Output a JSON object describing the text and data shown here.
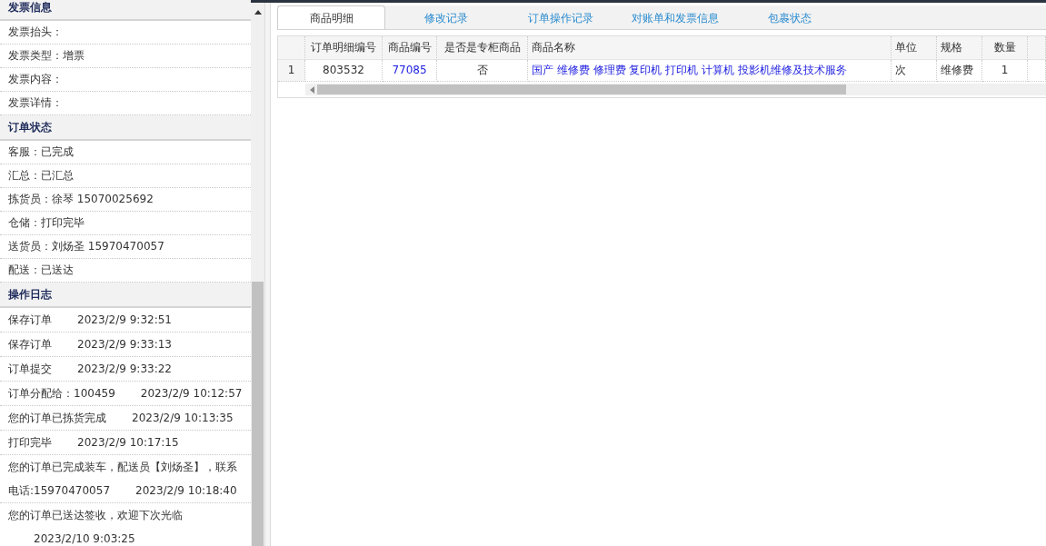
{
  "sections": [
    {
      "title": "发票信息",
      "items": [
        "发票抬头：",
        "发票类型：增票",
        "发票内容：",
        "发票详情："
      ]
    },
    {
      "title": "订单状态",
      "items": [
        "客服：已完成",
        "汇总：已汇总",
        "拣货员：徐琴 15070025692",
        "仓储：打印完毕",
        "送货员：刘炀圣 15970470057",
        "配送：已送达"
      ]
    }
  ],
  "log": {
    "title": "操作日志",
    "entries": [
      {
        "action": "保存订单",
        "time": "2023/2/9 9:32:51"
      },
      {
        "action": "保存订单",
        "time": "2023/2/9 9:33:13"
      },
      {
        "action": "订单提交",
        "time": "2023/2/9 9:33:22"
      },
      {
        "action": "订单分配给：100459",
        "time": "2023/2/9 10:12:57"
      },
      {
        "action": "您的订单已拣货完成",
        "time": "2023/2/9 10:13:35"
      },
      {
        "action": "打印完毕",
        "time": "2023/2/9 10:17:15"
      },
      {
        "action": "您的订单已完成装车，配送员【刘炀圣】，联系",
        "action_continued": "电话:15970470057",
        "time": "2023/2/9 10:18:40"
      },
      {
        "action": "您的订单已送达签收，欢迎下次光临",
        "time": "2023/2/10 9:03:25"
      }
    ]
  },
  "tabs": [
    {
      "label": "商品明细",
      "selected": true
    },
    {
      "label": "修改记录",
      "selected": false
    },
    {
      "label": "订单操作记录",
      "selected": false
    },
    {
      "label": "对账单和发票信息",
      "selected": false
    },
    {
      "label": "包裹状态",
      "selected": false
    }
  ],
  "table": {
    "columns": [
      "订单明细编号",
      "商品编号",
      "是否是专柜商品",
      "商品名称",
      "单位",
      "规格",
      "数量"
    ],
    "rows": [
      {
        "index": "1",
        "cells": [
          "803532",
          "77085",
          "否",
          "国产 维修费 修理费 复印机 打印机 计算机 投影机维修及技术服务",
          "次",
          "维修费",
          "1"
        ]
      }
    ]
  }
}
